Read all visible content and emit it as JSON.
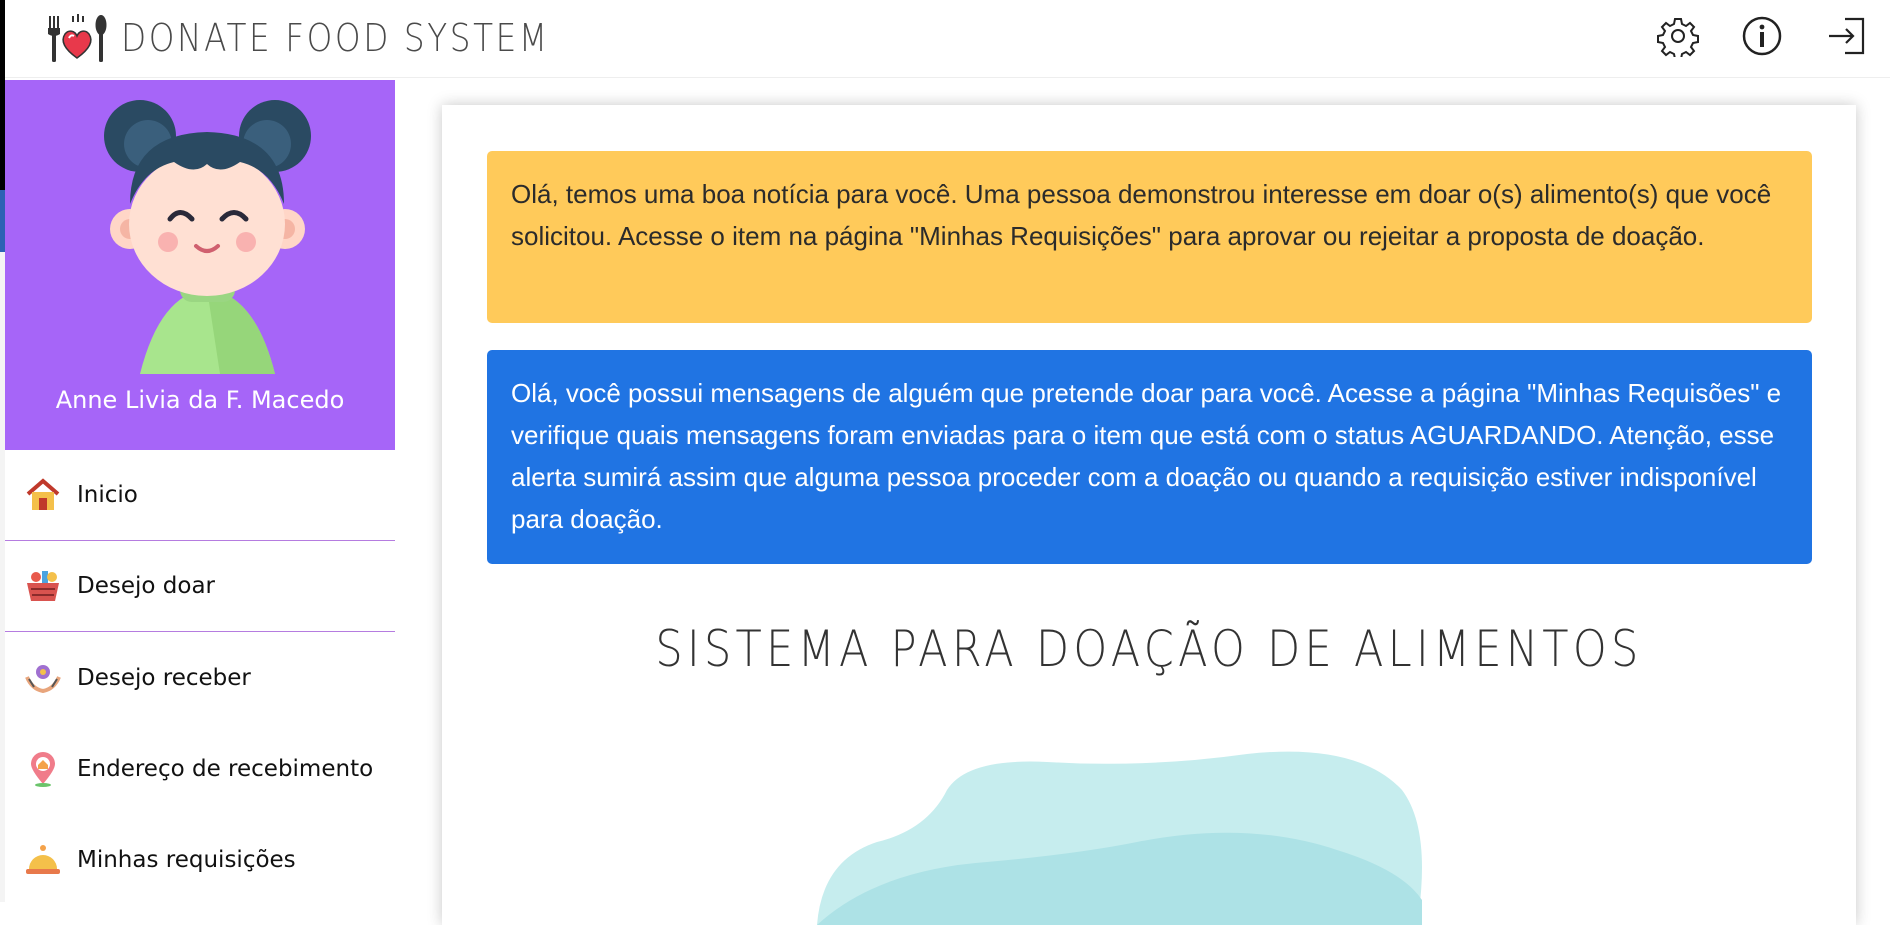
{
  "header": {
    "title": "DONATE FOOD SYSTEM",
    "icons": [
      "gear-icon",
      "info-icon",
      "logout-icon"
    ]
  },
  "sidebar": {
    "user_name": "Anne Livia da F. Macedo",
    "items": [
      {
        "label": "Inicio",
        "icon": "home-icon"
      },
      {
        "label": "Desejo doar",
        "icon": "food-basket-icon"
      },
      {
        "label": "Desejo receber",
        "icon": "receive-hands-icon"
      },
      {
        "label": "Endereço de recebimento",
        "icon": "location-pin-icon"
      },
      {
        "label": "Minhas requisições",
        "icon": "food-tray-icon"
      }
    ]
  },
  "main": {
    "alert_warning": "Olá, temos uma boa notícia para você. Uma pessoa demonstrou interesse em doar o(s) alimento(s) que você solicitou. Acesse o item na página \"Minhas Requisições\" para aprovar ou rejeitar a proposta de doação.",
    "alert_info": "Olá, você possui mensagens de alguém que pretende doar para você. Acesse a página \"Minhas Requisões\" e verifique quais mensagens foram enviadas para o item que está com o status AGUARDANDO. Atenção, esse alerta sumirá assim que alguma pessoa proceder com a doação ou quando a requisição estiver indisponível para doação.",
    "title": "SISTEMA PARA DOAÇÃO DE ALIMENTOS"
  },
  "colors": {
    "sidebar_profile_bg": "#a665f8",
    "alert_warning_bg": "#ffca5a",
    "alert_info_bg": "#2074e3",
    "nav_divider": "#b57ce0"
  }
}
